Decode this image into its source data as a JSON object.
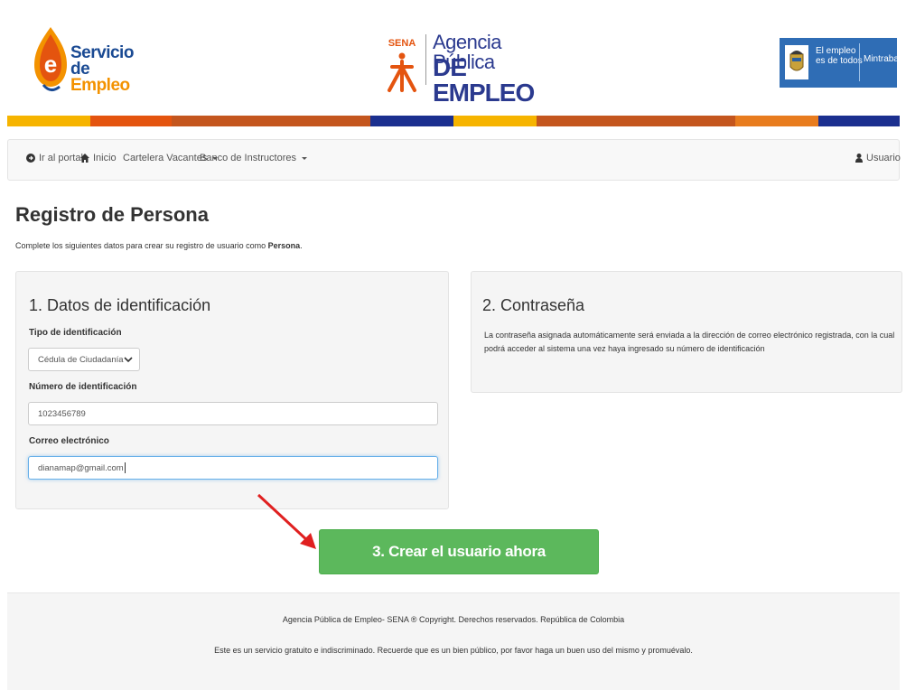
{
  "header": {
    "servicio_line1": "Servicio",
    "servicio_line2a": "de ",
    "servicio_line2b": "Empleo",
    "sena_mark": "SENA",
    "agency_line1": "Agencia Pública",
    "agency_line2": "DE EMPLEO",
    "gov_line1": "El empleo",
    "gov_line2": "es de todos",
    "gov_ministry": "Mintrabajo"
  },
  "colors": {
    "brand_blue": "#1a4a93",
    "brand_orange": "#f39200",
    "success_green": "#5cb85c",
    "gov_blue": "#2f6db5"
  },
  "nav": {
    "portal": "Ir al portal",
    "inicio": "Inicio",
    "cartelera": "Cartelera Vacantes",
    "banco": "Banco de Instructores",
    "usuario": "Usuario"
  },
  "page": {
    "title": "Registro de Persona",
    "subtitle_pre": "Complete los siguientes datos para crear su registro de usuario como ",
    "subtitle_bold": "Persona",
    "subtitle_post": "."
  },
  "identificacion": {
    "heading": "1. Datos de identificación",
    "tipo_label": "Tipo de identificación",
    "tipo_value": "Cédula de Ciudadanía",
    "numero_label": "Número de identificación",
    "numero_value": "1023456789",
    "correo_label": "Correo electrónico",
    "correo_value": "dianamap@gmail.com"
  },
  "contrasena": {
    "heading": "2. Contraseña",
    "text": "La contraseña asignada automáticamente será enviada a la dirección de correo electrónico registrada, con la cual podrá acceder al sistema una vez haya ingresado su número de identificación"
  },
  "cta": {
    "label": "3. Crear el usuario ahora"
  },
  "footer": {
    "line1": "Agencia Pública de Empleo- SENA ® Copyright. Derechos reservados. República de Colombia",
    "line2": "Este es un servicio gratuito e indiscriminado. Recuerde que es un bien público, por favor haga un buen uso del mismo y promuévalo."
  }
}
